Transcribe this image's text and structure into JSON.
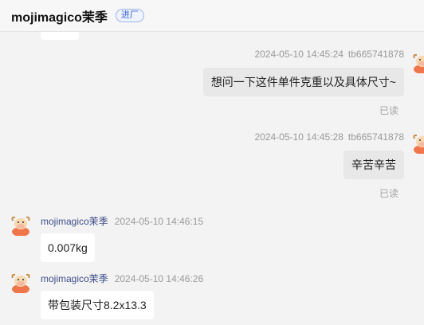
{
  "header": {
    "title": "mojimagico茉季",
    "badge": "进厂"
  },
  "messages": [
    {
      "side": "right",
      "time": "2024-05-10 14:45:24",
      "sender": "tb665741878",
      "text": "想问一下这件单件克重以及具体尺寸~",
      "status": "已读"
    },
    {
      "side": "right",
      "time": "2024-05-10 14:45:28",
      "sender": "tb665741878",
      "text": "辛苦辛苦",
      "status": "已读"
    },
    {
      "side": "left",
      "sender": "mojimagico茉季",
      "time": "2024-05-10 14:46:15",
      "text": "0.007kg"
    },
    {
      "side": "left",
      "sender": "mojimagico茉季",
      "time": "2024-05-10 14:46:26",
      "text": "带包装尺寸8.2x13.3"
    }
  ],
  "icons": {
    "avatar": "cartoon-cow-avatar-icon"
  },
  "colors": {
    "background": "#f3f3f3",
    "right_bubble": "#e8e8e8",
    "left_bubble": "#ffffff",
    "sender_name": "#3f4d8a",
    "badge": "#3b66d6"
  }
}
